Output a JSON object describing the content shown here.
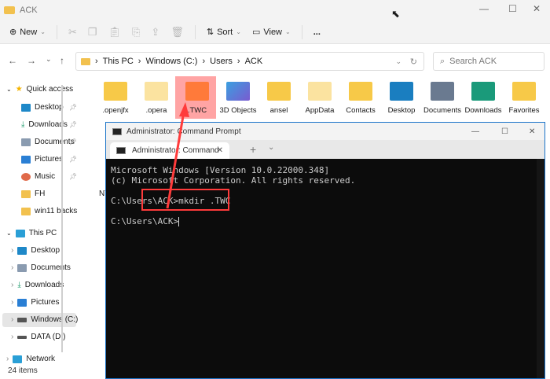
{
  "explorer": {
    "title": "ACK",
    "toolbar": {
      "new": "New",
      "sort": "Sort",
      "view": "View",
      "more": "..."
    },
    "breadcrumb": [
      "This PC",
      "Windows (C:)",
      "Users",
      "ACK"
    ],
    "search_placeholder": "Search ACK",
    "sidebar": {
      "quick_access": "Quick access",
      "quick_items": [
        "Desktop",
        "Downloads",
        "Documents",
        "Pictures",
        "Music",
        "FH",
        "win11 backs"
      ],
      "this_pc": "This PC",
      "pc_items": [
        "Desktop",
        "Documents",
        "Downloads",
        "Pictures",
        "Windows (C:)",
        "DATA (D:)"
      ],
      "network": "Network"
    },
    "files": [
      ".openjfx",
      ".opera",
      ".TWC",
      "3D Objects",
      "ansel",
      "AppData",
      "Contacts",
      "Desktop",
      "Documents",
      "Downloads",
      "Favorites"
    ],
    "partial_label": "NT",
    "status": "24 items"
  },
  "cmd": {
    "title": "Administrator: Command Prompt",
    "tab": "Administrator: Command Prompt",
    "lines": [
      "Microsoft Windows [Version 10.0.22000.348]",
      "(c) Microsoft Corporation. All rights reserved.",
      "",
      "C:\\Users\\ACK>mkdir .TWC",
      "",
      "C:\\Users\\ACK>"
    ]
  },
  "colors": {
    "highlight": "#ff3b3b",
    "accent": "#1a73c8"
  }
}
